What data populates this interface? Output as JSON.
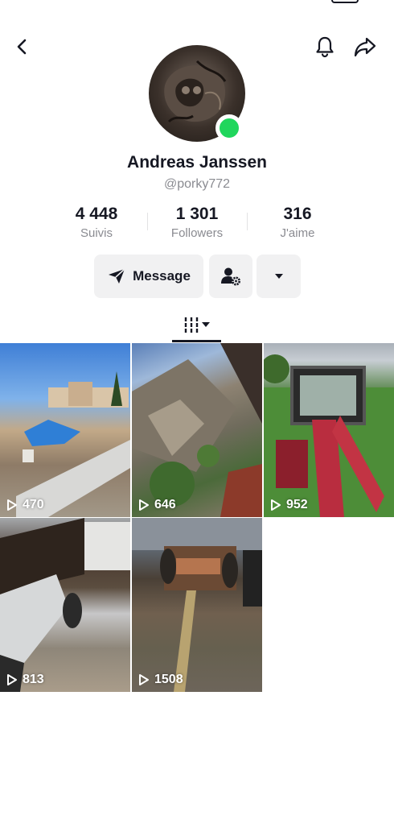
{
  "profile": {
    "display_name": "Andreas Janssen",
    "handle": "@porky772",
    "online_color": "#20d65c"
  },
  "stats": [
    {
      "value": "4 448",
      "label": "Suivis"
    },
    {
      "value": "1 301",
      "label": "Followers"
    },
    {
      "value": "316",
      "label": "J'aime"
    }
  ],
  "actions": {
    "message_label": "Message",
    "message_icon": "send-icon",
    "follow_icon": "person-gear-icon",
    "more_icon": "caret-down-icon"
  },
  "header": {
    "back_icon": "chevron-left-icon",
    "notification_icon": "bell-icon",
    "share_icon": "share-arrow-icon"
  },
  "tabs": {
    "grid_icon": "video-grid-icon"
  },
  "videos": [
    {
      "views": "470"
    },
    {
      "views": "646"
    },
    {
      "views": "952"
    },
    {
      "views": "813"
    },
    {
      "views": "1508"
    }
  ],
  "colors": {
    "text": "#161823",
    "secondary": "#8a8b91",
    "button_bg": "#f1f1f2"
  }
}
